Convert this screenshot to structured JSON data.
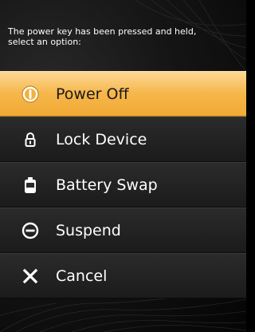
{
  "dialog": {
    "prompt": "The power key has been pressed and held,\nselect an option:"
  },
  "menu": {
    "items": [
      {
        "label": "Power Off",
        "icon": "power-icon",
        "selected": true
      },
      {
        "label": "Lock Device",
        "icon": "lock-icon",
        "selected": false
      },
      {
        "label": "Battery Swap",
        "icon": "battery-icon",
        "selected": false
      },
      {
        "label": "Suspend",
        "icon": "suspend-icon",
        "selected": false
      },
      {
        "label": "Cancel",
        "icon": "close-icon",
        "selected": false
      }
    ]
  },
  "colors": {
    "highlight": "#f3b03e",
    "item_background": "#222222",
    "screen_background": "#0e0e0e"
  }
}
